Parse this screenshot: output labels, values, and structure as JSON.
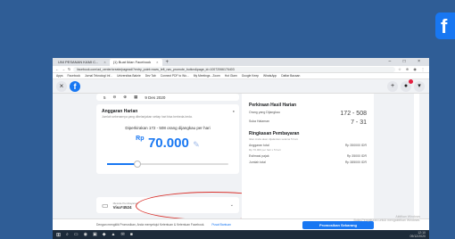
{
  "fb_logo": "f",
  "browser": {
    "tabs": [
      {
        "label": "UNI PESANAN KAMI C...",
        "active": false
      },
      {
        "label": "(1) Buat Iklan Facebook",
        "active": true
      }
    ],
    "new_tab": "+",
    "window_controls": "– □ ×",
    "url": "facebook.com/ad_center/create/pagead/?entry_point=www_left_nav_promote_button&page_id=10072066176403",
    "bookmarks": [
      "Apps",
      "Facebook",
      "Jurnal Teknologi Inf...",
      "Universitas Bakrie",
      "Dev Tab",
      "Connect PDF to Wo...",
      "My Meetings - Zoom",
      "Hot Glam",
      "Google Keep",
      "WhatsApp",
      "Daftar Bacaan"
    ],
    "extensions": "☆ ⊕ ◉ ⋮"
  },
  "facebook_bar": {
    "close": "×",
    "logo": "f",
    "controls": [
      "+",
      "●",
      "▾"
    ]
  },
  "left_panel": {
    "schedule_row": {
      "days": "5",
      "date": "9 Des 2020"
    },
    "budget": {
      "title": "Anggaran Harian",
      "subtitle": "Jumlah sebenarnya yang dibelanjakan setiap hari bisa berbeda-beda.",
      "reach": "Diperkirakan 172 - 508 orang dijangkau per hari",
      "currency": "Rp",
      "amount": "70.000",
      "slider_level": 0.25
    },
    "payment": {
      "label": "Metode Pembayaran",
      "value": "Visa*4524"
    }
  },
  "right_panel": {
    "results_title": "Perkiraan Hasil Harian",
    "reached_label": "Orang yang Dijangkau",
    "reached_value": "172 - 508",
    "clicks_label": "Suka Halaman",
    "clicks_value": "7 - 31",
    "summary_title": "Ringkasan Pembayaran",
    "summary_sub": "Iklan Anda akan dijalankan selama 5 hari.",
    "total_budget_label": "Anggaran total",
    "total_budget_note": "Rp 70.000 per hari x 5 hari",
    "total_budget_value": "Rp 350000 IDR",
    "tax_label": "Estimasi pajak",
    "tax_value": "Rp 35000 IDR",
    "total_label": "Jumlah total",
    "total_value": "Rp 385000 IDR"
  },
  "footer": {
    "terms": "Dengan mengklik Promosikan, Anda menyetujui Ketentuan & Ketentuan Facebook.",
    "help": "Pusat Bantuan",
    "promote_button": "Promosikan Sekarang",
    "watermark_line1": "Aktifkan Windows",
    "watermark_line2": "Buka Pengaturan untuk mengaktifkan Windows."
  },
  "taskbar": {
    "start": "⊞",
    "apps": [
      "⌕",
      "▭",
      "◉",
      "▣",
      "◆",
      "▲",
      "✉",
      "■"
    ],
    "time": "12:10",
    "date": "09/12/2020"
  }
}
